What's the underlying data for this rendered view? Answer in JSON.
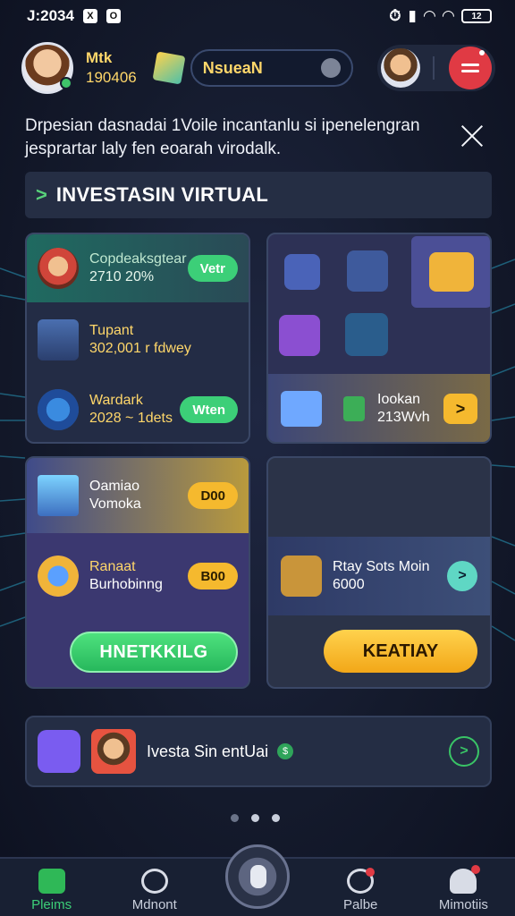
{
  "status_bar": {
    "time": "J:2034",
    "icon1": "X",
    "icon2": "O",
    "battery": "12"
  },
  "header": {
    "username": "Mtk",
    "coins": "190406",
    "search_value": "NsueaN"
  },
  "notice": {
    "text": "Drpesian dasnadai 1Voile incantanlu si ipenelengran jesprartar laly fen eoarah virodalk."
  },
  "section": {
    "arrow": ">",
    "title": "INVESTASIN VIRTUAL"
  },
  "left_top": {
    "rows": [
      {
        "title": "Copdeaksgtear",
        "value": "2710 20%",
        "button": "Vetr"
      },
      {
        "title": "Tupant",
        "value": "302,001 r fdwey",
        "button": ""
      },
      {
        "title": "Wardark",
        "value": "2028 ~ 1dets",
        "button": "Wten"
      }
    ]
  },
  "right_top": {
    "strip": {
      "line1": "Iookan",
      "line2": "213Wvh",
      "arrow": ">"
    }
  },
  "left_bottom": {
    "rows": [
      {
        "title": "Oamiao",
        "subtitle": "Vomoka",
        "button": "D00"
      },
      {
        "title": "Ranaat",
        "subtitle": "Burhobinng",
        "button": "B00"
      }
    ],
    "main_button": "HNETKKILG"
  },
  "right_bottom": {
    "card": {
      "line1": "Rtay Sots Moin",
      "line2": "6000",
      "arrow": ">"
    },
    "main_button": "KEATIAY"
  },
  "bottom_card": {
    "text": "Ivesta Sin entUai",
    "badge": "$",
    "arrow": ">"
  },
  "nav": {
    "items": [
      {
        "label": "Pleims"
      },
      {
        "label": "Mdnont"
      },
      {
        "label": "Palbe"
      },
      {
        "label": "Mimotiis"
      }
    ]
  },
  "colors": {
    "accent_green": "#3ccf78",
    "accent_gold": "#f5b92e",
    "alert_red": "#e03a44"
  }
}
